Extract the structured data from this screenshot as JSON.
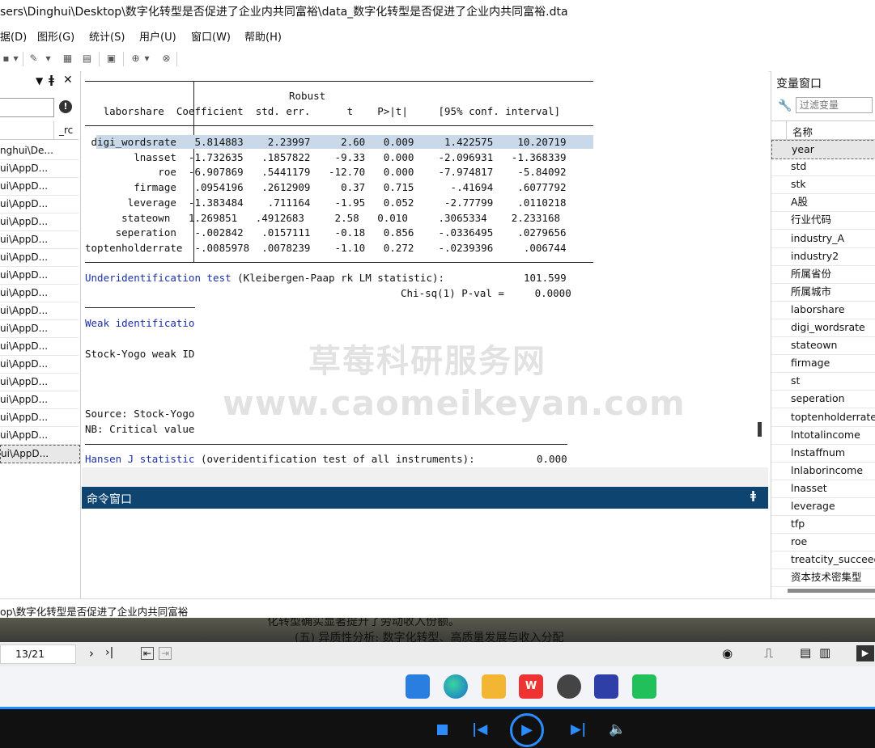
{
  "title": "sers\\Dinghui\\Desktop\\数字化转型是否促进了企业内共同富裕\\data_数字化转型是否促进了企业内共同富裕.dta",
  "menu": [
    "据(D)",
    "图形(G)",
    "统计(S)",
    "用户(U)",
    "窗口(W)",
    "帮助(H)"
  ],
  "left_panel": {
    "col2": "_rc",
    "rows": [
      "nghui\\De...",
      "ui\\AppD...",
      "ui\\AppD...",
      "ui\\AppD...",
      "ui\\AppD...",
      "ui\\AppD...",
      "ui\\AppD...",
      "ui\\AppD...",
      "ui\\AppD...",
      "ui\\AppD...",
      "ui\\AppD...",
      "ui\\AppD...",
      "ui\\AppD...",
      "ui\\AppD...",
      "ui\\AppD...",
      "ui\\AppD...",
      "ui\\AppD...",
      "ui\\AppD..."
    ]
  },
  "results": {
    "header_robust": "Robust",
    "header": "   laborshare  Coefficient  std. err.      t    P>|t|     [95% conf. interval]",
    "rows": [
      " digi_wordsrate   5.814883    2.23997     2.60   0.009     1.422575    10.20719",
      "        lnasset  -1.732635   .1857822    -9.33   0.000    -2.096931   -1.368339",
      "            roe  -6.907869   .5441179   -12.70   0.000    -7.974817    -5.84092",
      "        firmage   .0954196   .2612909     0.37   0.715      -.41694    .6077792",
      "       leverage  -1.383484    .711164    -1.95   0.052     -2.77799    .0110218",
      "      stateown   1.269851   .4912683     2.58   0.010     .3065334    2.233168",
      "     seperation   -.002842   .0157111    -0.18   0.856    -.0336495    .0279656",
      "toptenholderrate  -.0085978  .0078239    -1.10   0.272    -.0239396     .006744"
    ],
    "underid_link": "Underidentification test",
    "underid_rest": " (Kleibergen-Paap rk LM statistic):",
    "underid_value": "101.599",
    "underid_chi": "Chi-sq(1) P-val =     0.0000",
    "weak_link": "Weak identificatio",
    "stock_yogo": "Stock-Yogo weak ID",
    "source": "Source: Stock-Yogo",
    "nb": "NB: Critical value",
    "hansen_link": "Hansen J statistic",
    "hansen_rest": " (overidentification test of all instruments):",
    "hansen_value": "0.000"
  },
  "watermark": {
    "cn": "草莓科研服务网",
    "url": "www.caomeikeyan.com"
  },
  "command_window": {
    "title": "命令窗口",
    "pin": "ǂ"
  },
  "var_panel": {
    "title": "变量窗口",
    "filter_placeholder": "过滤变量",
    "col_name": "名称",
    "vars": [
      "year",
      "std",
      "stk",
      "A股",
      "行业代码",
      "industry_A",
      "industry2",
      "所属省份",
      "所属城市",
      "laborshare",
      "digi_wordsrate",
      "stateown",
      "firmage",
      "st",
      "seperation",
      "toptenholderrate",
      "lntotalincome",
      "lnstaffnum",
      "lnlaborincome",
      "lnasset",
      "leverage",
      "tfp",
      "roe",
      "treatcity_succeed",
      "资本技术密集型"
    ]
  },
  "status_path": "op\\数字化转型是否促进了企业内共同富裕",
  "pdf_text": "(五) 异质性分析: 数字化转型、高质量发展与收入分配",
  "pdf_text_top": "化转型确实显著提升了劳动收入份额。",
  "page_indicator": "13/21",
  "colors": {
    "accent": "#0e4470",
    "link": "#1a2fa8",
    "highlight": "#c9d9ea",
    "player_line": "#1e8fff"
  }
}
